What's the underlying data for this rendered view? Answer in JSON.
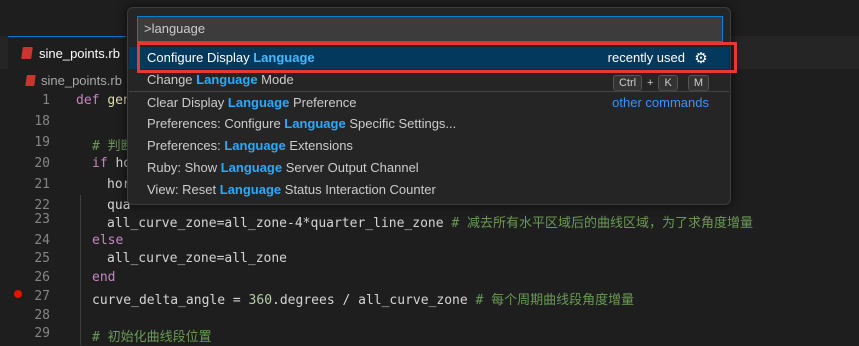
{
  "tab": {
    "label": "sine_points.rb",
    "icon": "ruby-icon"
  },
  "breadcrumb": {
    "file": "sine_points.rb",
    "icon": "ruby-icon"
  },
  "palette": {
    "input_value": ">language",
    "items": [
      {
        "pre": "Configure Display ",
        "hl": "Language",
        "post": "",
        "right": "recently used",
        "gear": "⚙"
      },
      {
        "pre": "Change ",
        "hl": "Language",
        "post": " Mode",
        "keys": [
          "Ctrl",
          "+",
          "K",
          "M"
        ]
      },
      {
        "pre": "Clear Display ",
        "hl": "Language",
        "post": " Preference",
        "right": "other commands"
      },
      {
        "pre": "Preferences: Configure ",
        "hl": "Language",
        "post": " Specific Settings..."
      },
      {
        "pre": "Preferences: ",
        "hl": "Language",
        "post": " Extensions"
      },
      {
        "pre": "Ruby: Show ",
        "hl": "Language",
        "post": " Server Output Channel"
      },
      {
        "pre": "View: Reset ",
        "hl": "Language",
        "post": " Status Interaction Counter"
      }
    ]
  },
  "editor": {
    "lines": [
      {
        "n": "1",
        "a": "def ",
        "b": "gen"
      },
      {
        "n": "18"
      },
      {
        "n": "19",
        "comment": "# 判断"
      },
      {
        "n": "20",
        "a": "if ",
        "b": "ho"
      },
      {
        "n": "21",
        "text": "hor"
      },
      {
        "n": "22",
        "text": "qua"
      },
      {
        "n": "23",
        "text": "all_curve_zone=all_zone-4*quarter_line_zone ",
        "comment": "# 减去所有水平区域后的曲线区域，为了求角度增量"
      },
      {
        "n": "24",
        "a": "else"
      },
      {
        "n": "25",
        "text": "all_curve_zone=all_zone"
      },
      {
        "n": "26",
        "a": "end"
      },
      {
        "n": "27",
        "text": "curve_delta_angle = ",
        "num": "360",
        "text2": ".degrees / all_curve_zone ",
        "comment": "# 每个周期曲线段角度增量"
      },
      {
        "n": "28"
      },
      {
        "n": "29",
        "comment": "# 初始化曲线段位置"
      }
    ]
  },
  "colors": {
    "accent": "#007fd4",
    "highlight": "#2aaaff",
    "selection": "#04395e",
    "annotation": "#e53935",
    "breakpoint": "#e51400"
  }
}
